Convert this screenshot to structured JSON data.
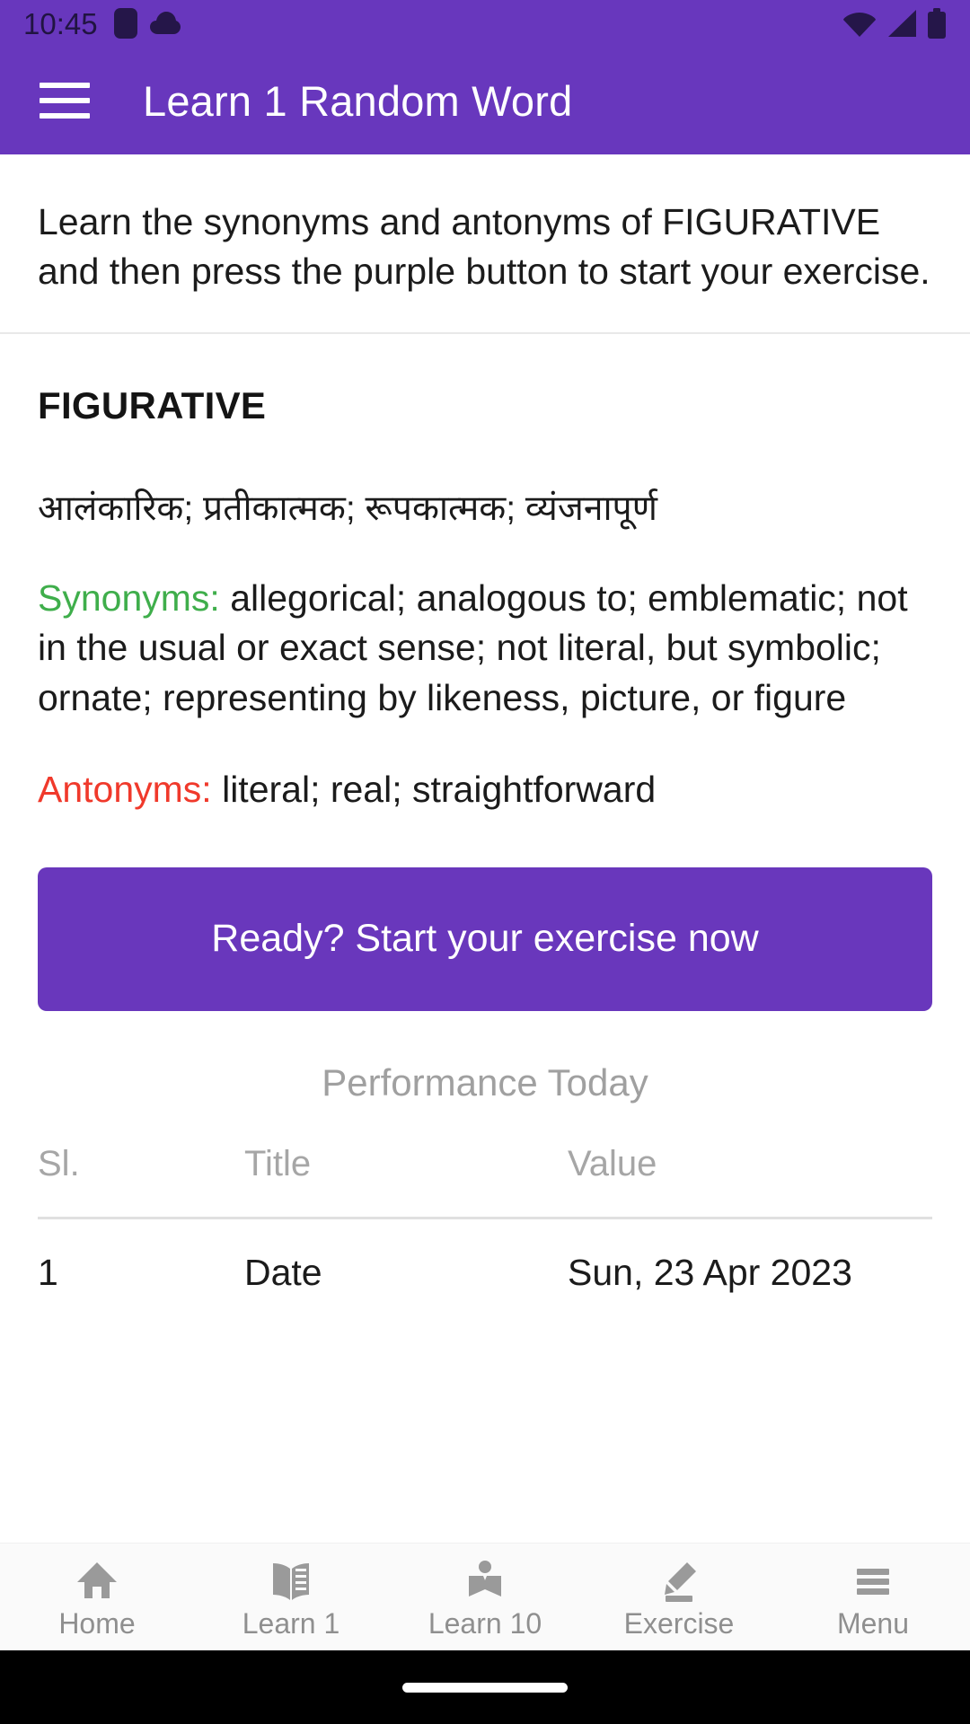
{
  "status_bar": {
    "time": "10:45",
    "left_icons": [
      "square-badge-icon",
      "cloud-icon"
    ],
    "right_icons": [
      "wifi-icon",
      "cellular-signal-icon",
      "battery-icon"
    ],
    "icon_color": "#251649",
    "background": "#6837bd"
  },
  "app_bar": {
    "menu_icon": "hamburger-menu-icon",
    "title": "Learn 1 Random Word",
    "background": "#6837bd",
    "text_color": "#ffffff"
  },
  "main": {
    "instruction": "Learn the synonyms and antonyms of FIGURATIVE and then press the purple button to start your exercise.",
    "word": "FIGURATIVE",
    "translation": "आलंकारिक; प्रतीकात्मक; रूपकात्मक; व्यंजनापूर्ण",
    "synonyms_label": "Synonyms:",
    "synonyms_label_color": "#3fae4b",
    "synonyms_text": " allegorical; analogous to; emblematic; not in the usual or exact sense; not literal, but symbolic; ornate; representing by likeness, picture, or figure",
    "antonyms_label": "Antonyms:",
    "antonyms_label_color": "#f0392b",
    "antonyms_text": " literal; real; straightforward",
    "start_button_label": "Ready? Start your exercise now",
    "start_button_color": "#6937bc"
  },
  "performance": {
    "heading": "Performance Today",
    "columns": [
      "Sl.",
      "Title",
      "Value"
    ],
    "rows": [
      {
        "sl": "1",
        "title": "Date",
        "value": "Sun, 23 Apr 2023"
      }
    ]
  },
  "bottom_nav": {
    "items": [
      {
        "label": "Home",
        "icon": "home-icon"
      },
      {
        "label": "Learn 1",
        "icon": "open-book-icon"
      },
      {
        "label": "Learn 10",
        "icon": "local-library-icon"
      },
      {
        "label": "Exercise",
        "icon": "pencil-edit-icon"
      },
      {
        "label": "Menu",
        "icon": "hamburger-menu-icon"
      }
    ],
    "inactive_color": "#9a9a9a"
  }
}
